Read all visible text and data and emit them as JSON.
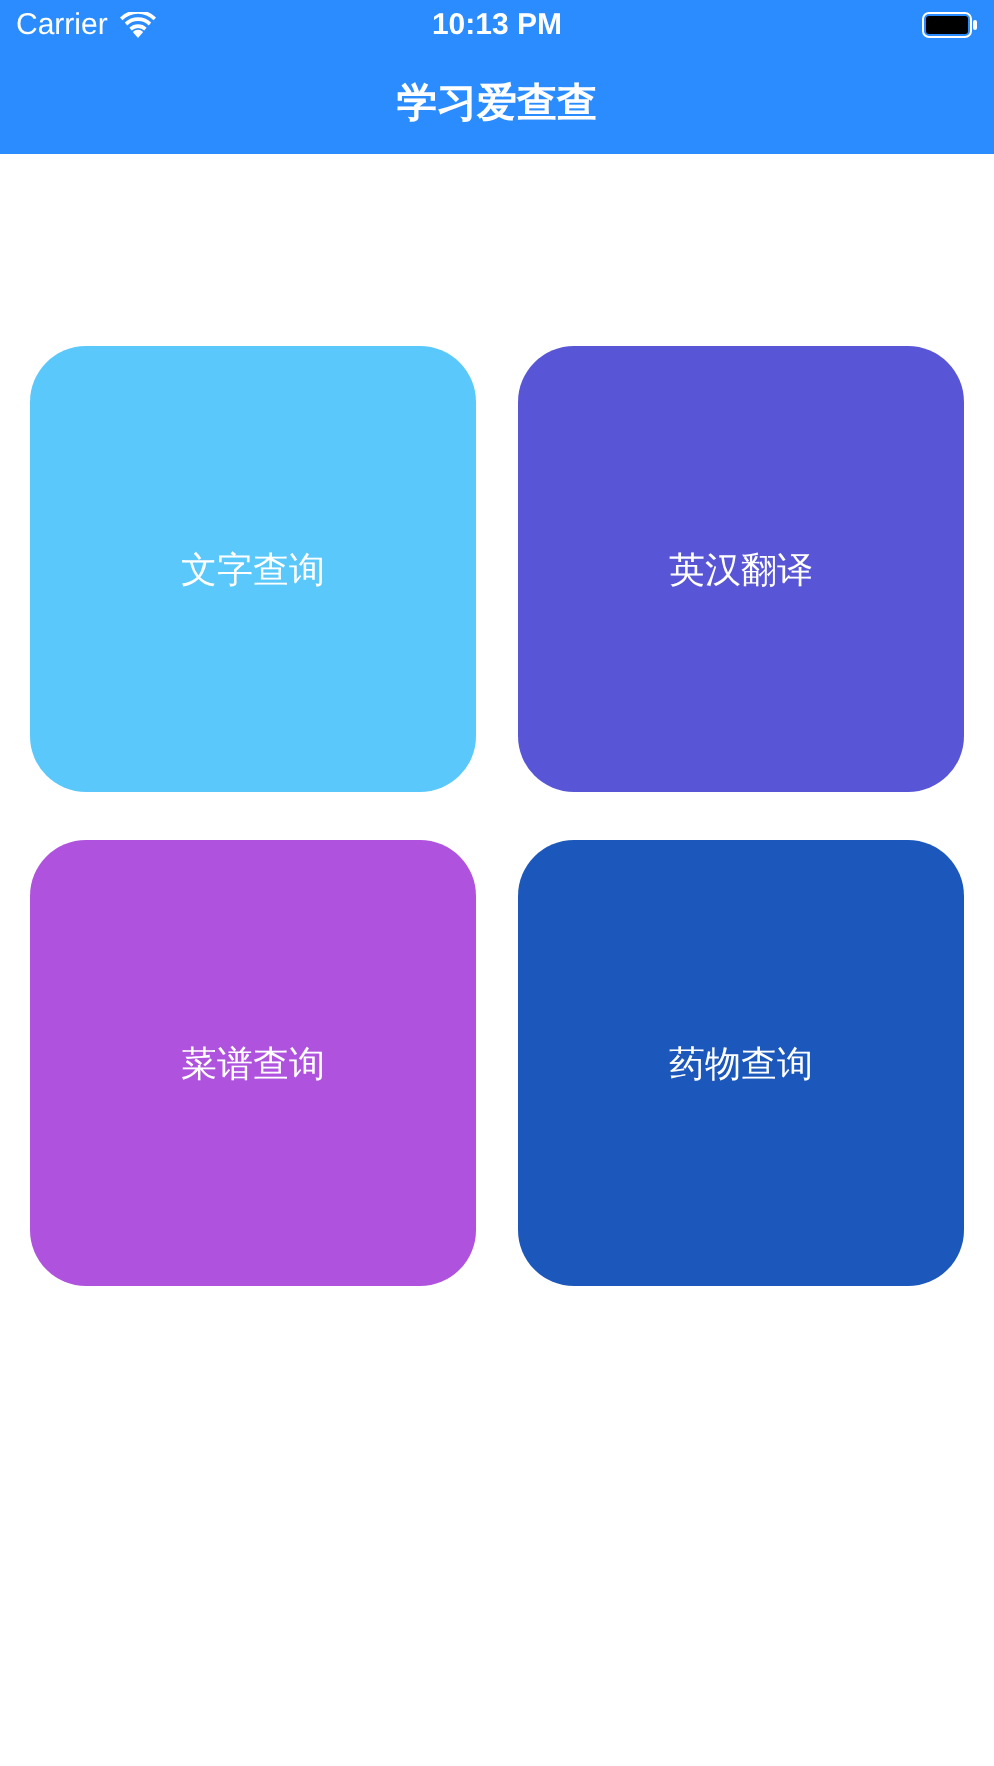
{
  "status_bar": {
    "carrier": "Carrier",
    "time": "10:13 PM"
  },
  "title": "学习爱查查",
  "tiles": [
    {
      "label": "文字查询",
      "color": "#5ac8fa"
    },
    {
      "label": "英汉翻译",
      "color": "#5856d6"
    },
    {
      "label": "菜谱查询",
      "color": "#af52de"
    },
    {
      "label": "药物查询",
      "color": "#1c58bb"
    }
  ]
}
